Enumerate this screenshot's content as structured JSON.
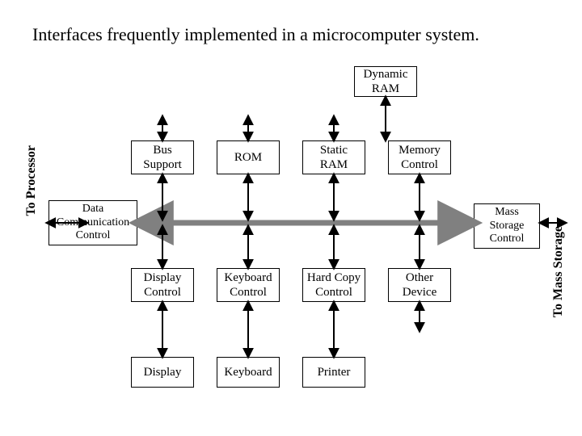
{
  "title": "Interfaces frequently implemented in a microcomputer system.",
  "labels": {
    "left": "To Processor",
    "right": "To Mass Storage"
  },
  "boxes": {
    "dynamicRam": "Dynamic\nRAM",
    "busSupport": "Bus\nSupport",
    "rom": "ROM",
    "staticRam": "Static\nRAM",
    "memoryControl": "Memory\nControl",
    "dataComm": "Data\nCommunication\nControl",
    "massStorage": "Mass\nStorage\nControl",
    "displayControl": "Display\nControl",
    "keyboardControl": "Keyboard\nControl",
    "hardCopyControl": "Hard Copy\nControl",
    "otherDevice": "Other\nDevice",
    "display": "Display",
    "keyboard": "Keyboard",
    "printer": "Printer"
  }
}
